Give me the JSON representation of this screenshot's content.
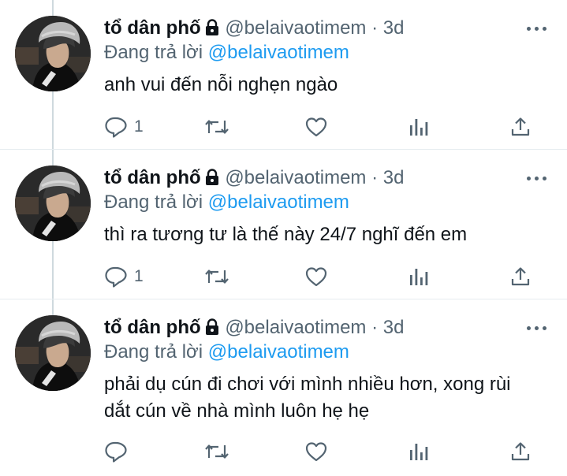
{
  "colors": {
    "text": "#0f1419",
    "secondary": "#536471",
    "link": "#1d9bf0",
    "divider": "#e6ecf0"
  },
  "icons": {
    "lock": "lock-icon",
    "more": "more-icon",
    "reply": "reply-icon",
    "retweet": "retweet-icon",
    "like": "like-icon",
    "views": "analytics-icon",
    "share": "share-icon"
  },
  "tweets": [
    {
      "display_name": "tổ dân phố",
      "handle": "@belaivaotimem",
      "separator": "·",
      "time": "3d",
      "reply_prefix": "Đang trả lời",
      "reply_to": "@belaivaotimem",
      "text_lines": [
        "anh vui đến nỗi nghẹn ngào"
      ],
      "reply_count": "1"
    },
    {
      "display_name": "tổ dân phố",
      "handle": "@belaivaotimem",
      "separator": "·",
      "time": "3d",
      "reply_prefix": "Đang trả lời",
      "reply_to": "@belaivaotimem",
      "text_lines": [
        "thì ra tương tư là thế này 24/7 nghĩ đến em"
      ],
      "reply_count": "1"
    },
    {
      "display_name": "tổ dân phố",
      "handle": "@belaivaotimem",
      "separator": "·",
      "time": "3d",
      "reply_prefix": "Đang trả lời",
      "reply_to": "@belaivaotimem",
      "text_lines": [
        "phải dụ cún đi chơi với mình nhiều hơn, xong rùi",
        "dắt cún về nhà mình luôn hẹ hẹ"
      ],
      "reply_count": ""
    }
  ]
}
